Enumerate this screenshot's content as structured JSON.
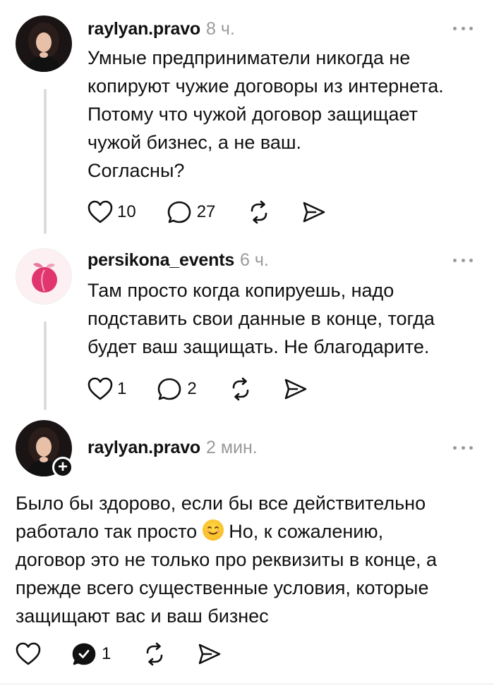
{
  "posts": [
    {
      "username": "raylyan.pravo",
      "time": "8 ч.",
      "text": "Умные предприниматели никогда не\nкопируют чужие договоры из интернета.\nПотому что чужой договор защищает\nчужой бизнес, а не ваш.\nСогласны?",
      "likes": "10",
      "comments": "27"
    },
    {
      "username": "persikona_events",
      "time": "6 ч.",
      "text": "Там просто когда копируешь, надо\nподставить свои данные в конце, тогда\nбудет ваш защищать. Не благодарите.",
      "likes": "1",
      "comments": "2"
    },
    {
      "username": "raylyan.pravo",
      "time": "2 мин.",
      "text_before_emoji": "Было бы здорово, если бы все действительно\nработало так просто ",
      "text_after_emoji": " Но, к сожалению,\nдоговор это не только про реквизиты в конце, а\nпрежде всего существенные условия, которые\nзащищают вас и ваш бизнес",
      "comments": "1"
    }
  ],
  "icons": {
    "like": "heart-icon",
    "comment": "speech-bubble-icon",
    "repost": "repost-icon",
    "share": "send-icon",
    "more": "ellipsis-icon",
    "emoji": "smiling-face-emoji",
    "follow": "plus-icon"
  },
  "colors": {
    "text": "#111111",
    "muted": "#9a9a9a",
    "thread_line": "#dcdcdc",
    "brand_peach": "#e0356f"
  }
}
